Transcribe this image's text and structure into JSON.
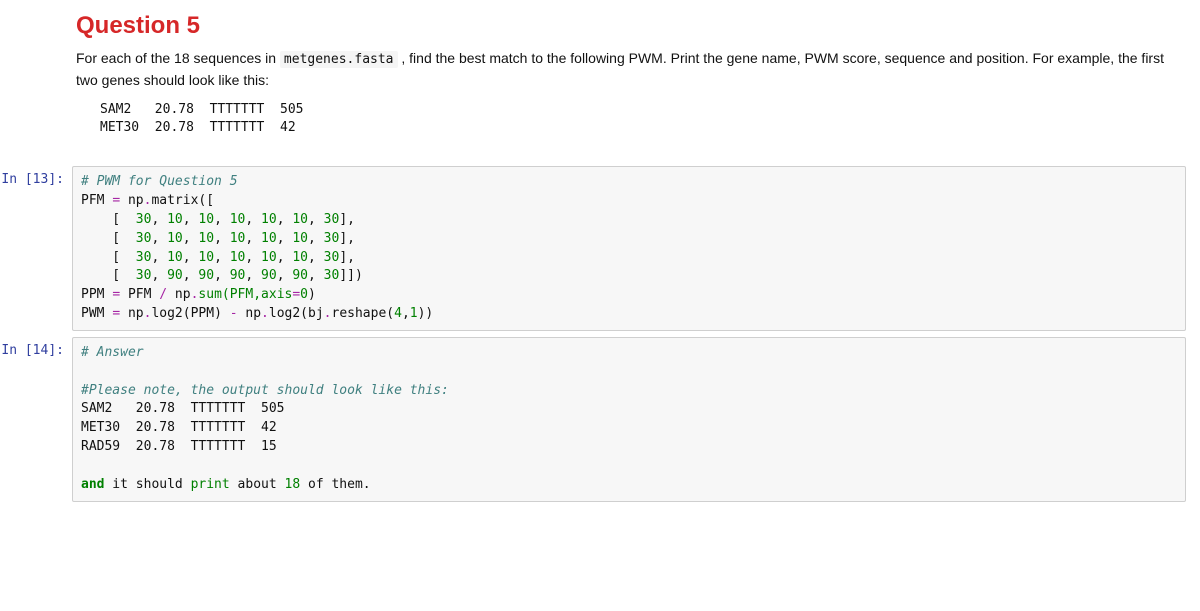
{
  "markdown": {
    "heading": "Question 5",
    "prose_pre": "For each of the 18 sequences in ",
    "prose_code": "metgenes.fasta",
    "prose_post": " , find the best match to the following PWM. Print the gene name, PWM score, sequence and position. For example, the first two genes should look like this:",
    "example_block": "SAM2   20.78  TTTTTTT  505\nMET30  20.78  TTTTTTT  42"
  },
  "cells": {
    "c1": {
      "prompt": "In [13]:",
      "lines": {
        "l1_comment": "# PWM for Question 5",
        "l2_a": "PFM ",
        "l2_op": "=",
        "l2_b": " np",
        "l2_dot": ".",
        "l2_c": "matrix([",
        "row1_a": "    [  ",
        "row1_b": ", ",
        "row1_c": "],",
        "row4_c": "]])",
        "pfm": {
          "r1": [
            "30",
            "10",
            "10",
            "10",
            "10",
            "10",
            "30"
          ],
          "r2": [
            "30",
            "10",
            "10",
            "10",
            "10",
            "10",
            "30"
          ],
          "r3": [
            "30",
            "10",
            "10",
            "10",
            "10",
            "10",
            "30"
          ],
          "r4": [
            "30",
            "90",
            "90",
            "90",
            "90",
            "90",
            "30"
          ]
        },
        "l7_a": "PPM ",
        "l7_op1": "=",
        "l7_b": " PFM ",
        "l7_op2": "/",
        "l7_c": " np",
        "l7_dot1": ".",
        "l7_d": "sum(PFM,axis",
        "l7_eq": "=",
        "l7_zero": "0",
        "l7_e": ")",
        "l8_a": "PWM ",
        "l8_op1": "=",
        "l8_b": " np",
        "l8_dot1": ".",
        "l8_c": "log2(PPM) ",
        "l8_op2": "-",
        "l8_d": " np",
        "l8_dot2": ".",
        "l8_e": "log2(bj",
        "l8_dot3": ".",
        "l8_f": "reshape(",
        "l8_n1": "4",
        "l8_g": ",",
        "l8_n2": "1",
        "l8_h": "))"
      }
    },
    "c2": {
      "prompt": "In [14]:",
      "lines": {
        "l1_comment": "# Answer",
        "blank": "",
        "l3_comment": "#Please note, the output should look like this:",
        "l4": "SAM2   20.78  TTTTTTT  505",
        "l5": "MET30  20.78  TTTTTTT  42",
        "l6": "RAD59  20.78  TTTTTTT  15",
        "l8_a": "and",
        "l8_b": " it should ",
        "l8_c": "print",
        "l8_d": " about ",
        "l8_e": "18",
        "l8_f": " of them."
      }
    }
  }
}
